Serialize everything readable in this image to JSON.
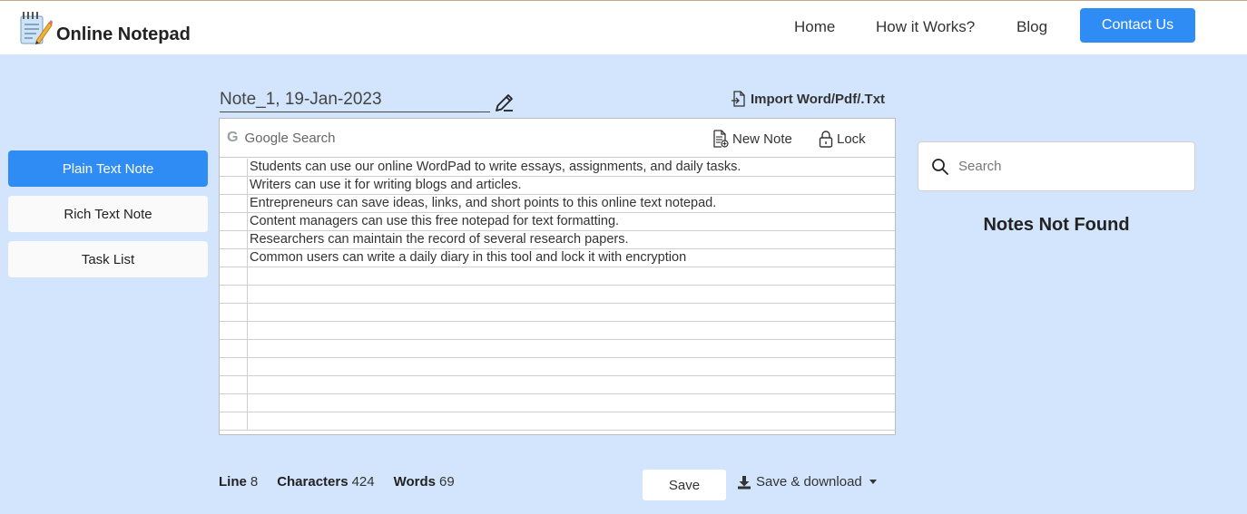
{
  "header": {
    "brand_name": "Online Notepad",
    "nav": [
      "Home",
      "How it Works?",
      "Blog"
    ],
    "contact_label": "Contact Us"
  },
  "sidebar": {
    "items": [
      {
        "label": "Plain Text Note",
        "active": true
      },
      {
        "label": "Rich Text Note",
        "active": false
      },
      {
        "label": "Task List",
        "active": false
      }
    ]
  },
  "note": {
    "title": "Note_1, 19-Jan-2023",
    "import_label": "Import Word/Pdf/.Txt"
  },
  "editor": {
    "search_label": "Google Search",
    "new_note_label": "New Note",
    "lock_label": "Lock",
    "lines": [
      "Students can use our online WordPad to write essays, assignments, and daily tasks.",
      "Writers can use it for writing blogs and articles.",
      "Entrepreneurs can save ideas, links, and short points to this online text notepad.",
      "Content managers can use this free notepad for text formatting.",
      "Researchers can maintain the record of several research papers.",
      "Common users can write a daily diary in this tool and lock it with encryption"
    ]
  },
  "notes_panel": {
    "search_placeholder": "Search",
    "empty_message": "Notes Not Found"
  },
  "stats": {
    "line_label": "Line",
    "line_value": "8",
    "chars_label": "Characters",
    "chars_value": "424",
    "words_label": "Words",
    "words_value": "69"
  },
  "actions": {
    "save_label": "Save",
    "save_download_label": "Save & download"
  },
  "colors": {
    "accent": "#2f8cf5",
    "background": "#d3e5fc"
  }
}
